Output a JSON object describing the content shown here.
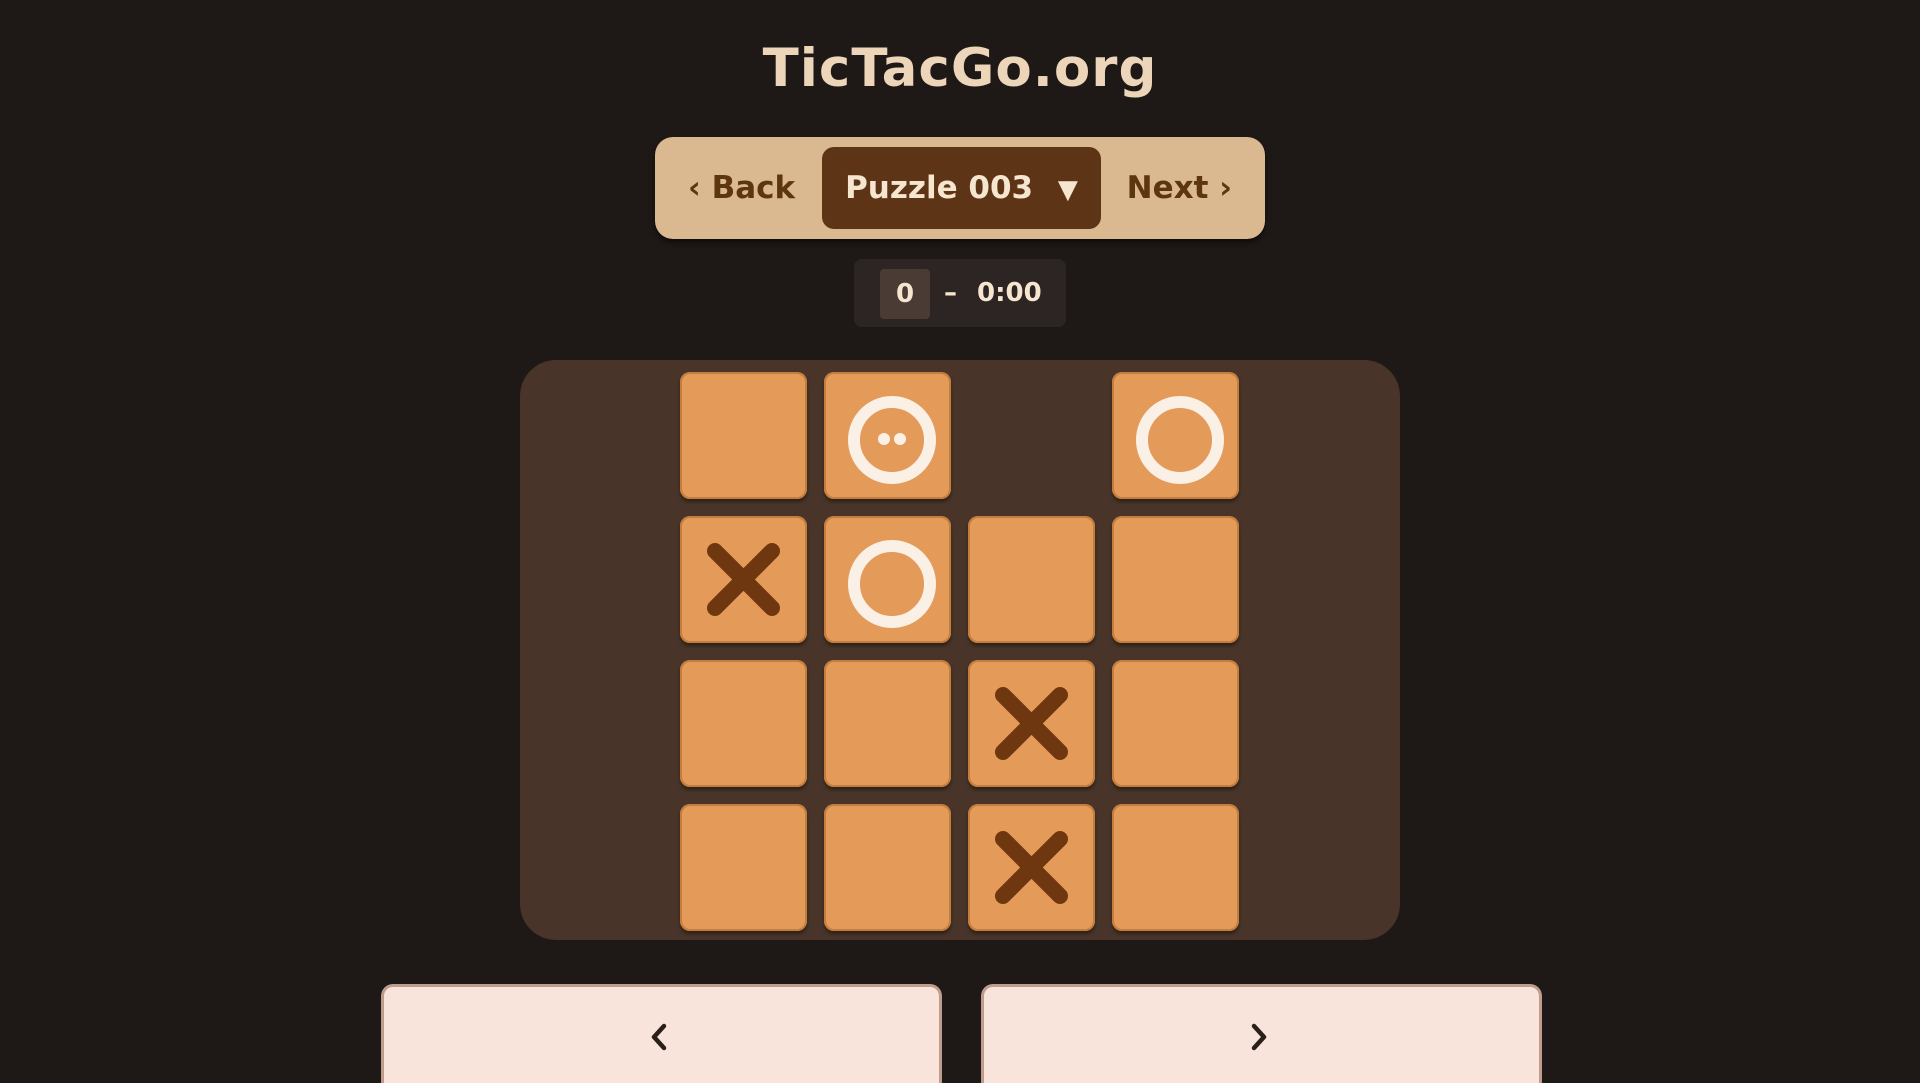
{
  "site": {
    "title": "TicTacGo.org"
  },
  "nav": {
    "back_label": "‹ Back",
    "puzzle_label": "Puzzle 003",
    "dropdown_arrow": "▼",
    "next_label": "Next ›"
  },
  "status": {
    "moves": "0",
    "separator": "–",
    "timer": "0:00"
  },
  "board": {
    "rows": 4,
    "cols": 4,
    "cells": [
      [
        "empty",
        "o-eyes",
        "none",
        "o"
      ],
      [
        "x",
        "o",
        "empty",
        "empty"
      ],
      [
        "empty",
        "empty",
        "x",
        "empty"
      ],
      [
        "empty",
        "empty",
        "x",
        "empty"
      ]
    ]
  },
  "controls": {
    "prev_icon": "chevron-left-icon",
    "next_icon": "chevron-right-icon"
  },
  "colors": {
    "background": "#1e1917",
    "board_panel": "#483428",
    "cell": "#e49b5a",
    "x_mark": "#6e3710",
    "o_mark": "#fbf0e6",
    "nav_bar": "#dab991",
    "nav_active": "#5d3516"
  }
}
